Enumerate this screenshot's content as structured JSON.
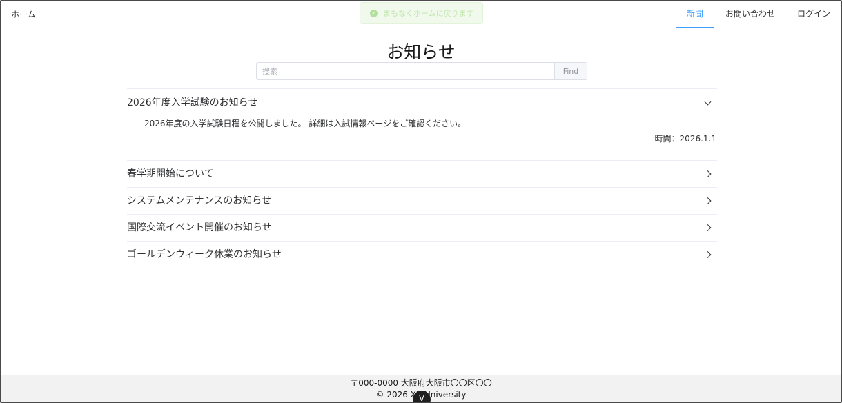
{
  "header": {
    "home_label": "ホーム",
    "nav": [
      {
        "label": "新聞",
        "active": true
      },
      {
        "label": "お問い合わせ",
        "active": false
      },
      {
        "label": "ログイン",
        "active": false
      }
    ]
  },
  "toast": {
    "message": "まもなくホームに戻ります",
    "icon": "check-circle-icon",
    "color": "#67c23a"
  },
  "main": {
    "title": "お知らせ",
    "search": {
      "placeholder": "搜索",
      "value": "",
      "button_label": "Find"
    },
    "notices": [
      {
        "title": "2026年度入学試験のお知らせ",
        "expanded": true,
        "body": "2026年度の入学試験日程を公開しました。 詳細は入試情報ページをご確認ください。",
        "time": "時間：2026.1.1"
      },
      {
        "title": "春学期開始について",
        "expanded": false
      },
      {
        "title": "システムメンテナンスのお知らせ",
        "expanded": false
      },
      {
        "title": "国際交流イベント開催のお知らせ",
        "expanded": false
      },
      {
        "title": "ゴールデンウィーク休業のお知らせ",
        "expanded": false
      }
    ]
  },
  "footer": {
    "address": "〒000-0000 大阪府大阪市〇〇区〇〇",
    "copyright": "© 2026 XX University"
  },
  "colors": {
    "accent": "#409eff",
    "border": "#ebeef5",
    "footer_bg": "#f2f2f2"
  }
}
